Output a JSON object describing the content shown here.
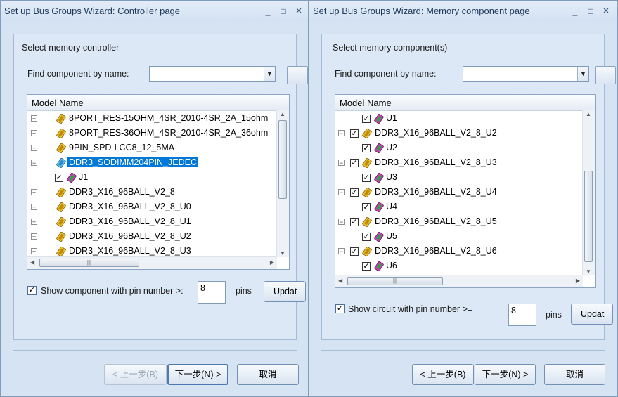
{
  "left": {
    "title": "Set up Bus Groups Wizard: Controller page",
    "section_label": "Select memory controller",
    "find_label": "Find component by name:",
    "find_value": "",
    "column_header": "Model Name",
    "rows": [
      {
        "label": "8PORT_RES-15OHM_4SR_2010-4SR_2A_15ohm",
        "expander": "+"
      },
      {
        "label": "8PORT_RES-36OHM_4SR_2010-4SR_2A_36ohm",
        "expander": "+"
      },
      {
        "label": "9PIN_SPD-LCC8_12_5MA",
        "expander": "+"
      },
      {
        "label": "DDR3_SODIMM204PIN_JEDEC",
        "expander": "−",
        "selected": true
      },
      {
        "label": "J1",
        "child": true,
        "checked": true
      },
      {
        "label": "DDR3_X16_96BALL_V2_8",
        "expander": "+"
      },
      {
        "label": "DDR3_X16_96BALL_V2_8_U0",
        "expander": "+"
      },
      {
        "label": "DDR3_X16_96BALL_V2_8_U1",
        "expander": "+"
      },
      {
        "label": "DDR3_X16_96BALL_V2_8_U2",
        "expander": "+"
      },
      {
        "label": "DDR3_X16_96BALL_V2_8_U3",
        "expander": "+"
      }
    ],
    "show_checkbox_label": "Show component with pin number >:",
    "show_checked": true,
    "pin_number": "8",
    "pins_label": "pins",
    "update_label": "Updat",
    "back_label": "< 上一步(B)",
    "next_label": "下一步(N) >",
    "cancel_label": "取消"
  },
  "right": {
    "title": "Set up Bus Groups Wizard: Memory component page",
    "section_label": "Select memory component(s)",
    "find_label": "Find component by name:",
    "find_value": "",
    "column_header": "Model Name",
    "rows": [
      {
        "label": "U1",
        "child": true,
        "checked": true
      },
      {
        "label": "DDR3_X16_96BALL_V2_8_U2",
        "expander": "−",
        "checked": true
      },
      {
        "label": "U2",
        "child": true,
        "checked": true
      },
      {
        "label": "DDR3_X16_96BALL_V2_8_U3",
        "expander": "−",
        "checked": true
      },
      {
        "label": "U3",
        "child": true,
        "checked": true
      },
      {
        "label": "DDR3_X16_96BALL_V2_8_U4",
        "expander": "−",
        "checked": true
      },
      {
        "label": "U4",
        "child": true,
        "checked": true
      },
      {
        "label": "DDR3_X16_96BALL_V2_8_U5",
        "expander": "−",
        "checked": true
      },
      {
        "label": "U5",
        "child": true,
        "checked": true
      },
      {
        "label": "DDR3_X16_96BALL_V2_8_U6",
        "expander": "−",
        "checked": true
      },
      {
        "label": "U6",
        "child": true,
        "checked": true
      }
    ],
    "show_checkbox_label": "Show circuit with pin number >=",
    "show_checked": true,
    "pin_number": "8",
    "pins_label": "pins",
    "update_label": "Updat",
    "back_label": "< 上一步(B)",
    "next_label": "下一步(N) >",
    "cancel_label": "取消"
  },
  "window_controls": {
    "minimize": "_",
    "maximize": "□",
    "close": "×"
  }
}
